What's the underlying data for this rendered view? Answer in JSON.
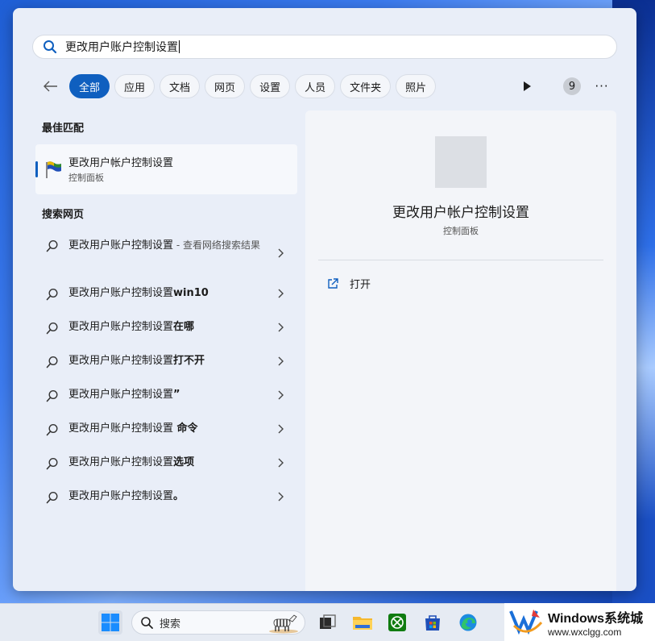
{
  "search": {
    "query": "更改用户账户控制设置"
  },
  "filters": [
    {
      "label": "全部",
      "active": true
    },
    {
      "label": "应用"
    },
    {
      "label": "文档"
    },
    {
      "label": "网页"
    },
    {
      "label": "设置"
    },
    {
      "label": "人员"
    },
    {
      "label": "文件夹"
    },
    {
      "label": "照片"
    }
  ],
  "badge_count": "9",
  "more_label": "···",
  "best_match": {
    "section": "最佳匹配",
    "title": "更改用户帐户控制设置",
    "subtitle": "控制面板"
  },
  "web": {
    "section": "搜索网页",
    "items": [
      {
        "prefix": "更改用户账户控制设置",
        "bold": "",
        "hint": " - 查看网络搜索结果"
      },
      {
        "prefix": "更改用户账户控制设置",
        "bold": "win10",
        "hint": ""
      },
      {
        "prefix": "更改用户账户控制设置",
        "bold": "在哪",
        "hint": ""
      },
      {
        "prefix": "更改用户账户控制设置",
        "bold": "打不开",
        "hint": ""
      },
      {
        "prefix": "更改用户账户控制设置",
        "bold": "”",
        "hint": ""
      },
      {
        "prefix": "更改用户账户控制设置",
        "bold": " 命令",
        "hint": ""
      },
      {
        "prefix": "更改用户账户控制设置",
        "bold": "选项",
        "hint": ""
      },
      {
        "prefix": "更改用户账户控制设置",
        "bold": "。",
        "hint": ""
      }
    ]
  },
  "preview": {
    "title": "更改用户帐户控制设置",
    "subtitle": "控制面板",
    "open_label": "打开"
  },
  "taskbar": {
    "search_label": "搜索"
  },
  "watermark": {
    "main": "Windows系统城",
    "url": "www.wxclgg.com"
  },
  "colors": {
    "accent": "#0f5fbf",
    "panel": "#e9eef8"
  }
}
